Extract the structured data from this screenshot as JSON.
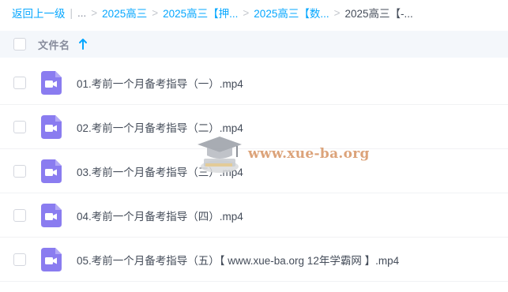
{
  "breadcrumb": {
    "back": "返回上一级",
    "ellipsis": "...",
    "separator": ">",
    "items": [
      "2025高三",
      "2025高三【押...",
      "2025高三【数..."
    ],
    "current": "2025高三【-..."
  },
  "header": {
    "name_label": "文件名",
    "sort_icon": "arrow-up-icon"
  },
  "files": [
    {
      "name": "01.考前一个月备考指导（一）.mp4",
      "icon": "video-icon"
    },
    {
      "name": "02.考前一个月备考指导（二）.mp4",
      "icon": "video-icon"
    },
    {
      "name": "03.考前一个月备考指导（三）.mp4",
      "icon": "video-icon"
    },
    {
      "name": "04.考前一个月备考指导（四）.mp4",
      "icon": "video-icon"
    },
    {
      "name": "05.考前一个月备考指导（五）【 www.xue-ba.org 12年学霸网 】.mp4",
      "icon": "video-icon"
    }
  ],
  "watermark": {
    "text": "www.xue-ba.org",
    "icon": "graduation-cap-logo"
  },
  "colors": {
    "link": "#06a7ff",
    "video_icon": "#8a7cf0",
    "header_bg": "#f4f7fb",
    "watermark": "#d99a6c"
  }
}
